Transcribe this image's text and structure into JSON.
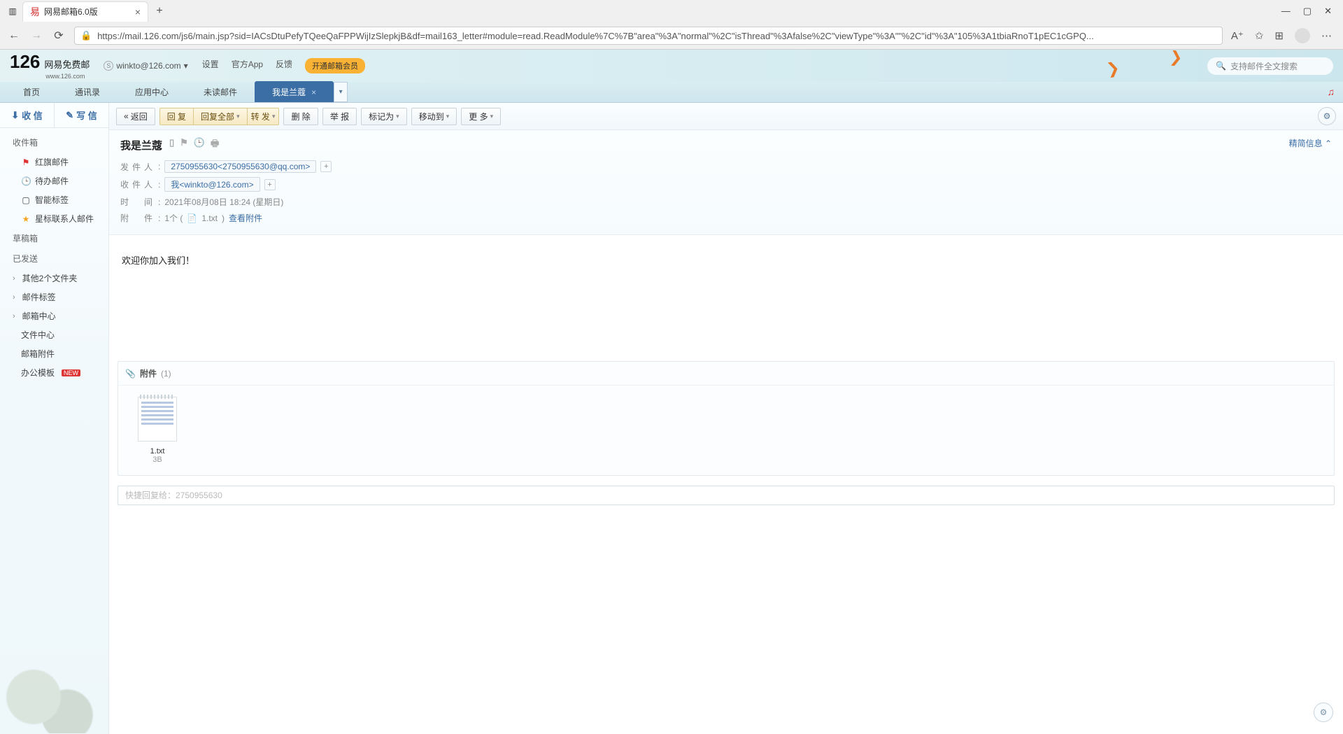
{
  "browser": {
    "tab_title": "网易邮箱6.0版",
    "url": "https://mail.126.com/js6/main.jsp?sid=IACsDtuPefyTQeeQaFPPWijIzSlepkjB&df=mail163_letter#module=read.ReadModule%7C%7B\"area\"%3A\"normal\"%2C\"isThread\"%3Afalse%2C\"viewType\"%3A\"\"%2C\"id\"%3A\"105%3A1tbiaRnoT1pEC1cGPQ..."
  },
  "header": {
    "logo_num": "126",
    "logo_text": "网易免费邮",
    "logo_sub": "www.126.com",
    "account": "winkto@126.com",
    "links": {
      "settings": "设置",
      "app": "官方App",
      "feedback": "反馈"
    },
    "vip": "开通邮箱会员",
    "search_placeholder": "支持邮件全文搜索"
  },
  "main_tabs": {
    "home": "首页",
    "contacts": "通讯录",
    "apps": "应用中心",
    "unread": "未读邮件",
    "current": "我是兰蔻"
  },
  "side": {
    "receive": "收 信",
    "compose": "写 信",
    "inbox_head": "收件箱",
    "redflag": "红旗邮件",
    "todo": "待办邮件",
    "smart": "智能标签",
    "starred": "星标联系人邮件",
    "drafts": "草稿箱",
    "sent": "已发送",
    "other": "其他2个文件夹",
    "tags": "邮件标签",
    "center": "邮箱中心",
    "files": "文件中心",
    "attach": "邮箱附件",
    "tpl": "办公模板",
    "new_badge": "NEW"
  },
  "toolbar": {
    "back": "返回",
    "reply": "回 复",
    "reply_all": "回复全部",
    "forward": "转 发",
    "delete": "删 除",
    "spam": "举 报",
    "mark": "标记为",
    "move": "移动到",
    "more": "更 多"
  },
  "message": {
    "subject": "我是兰蔻",
    "labels": {
      "from": "发件人",
      "to": "收件人",
      "time": "时   间",
      "attach": "附   件"
    },
    "from": "2750955630<2750955630@qq.com>",
    "to": "我<winkto@126.com>",
    "time": "2021年08月08日 18:24 (星期日)",
    "attach_count": "1个 (",
    "attach_name_inline": "1.txt",
    "attach_view": "查看附件",
    "simple_info": "精简信息",
    "body": "欢迎你加入我们！"
  },
  "attachments": {
    "title": "附件",
    "count": "(1)",
    "items": [
      {
        "name": "1.txt",
        "size": "3B"
      }
    ]
  },
  "quick_reply": {
    "placeholder": "快捷回复给：2750955630"
  }
}
